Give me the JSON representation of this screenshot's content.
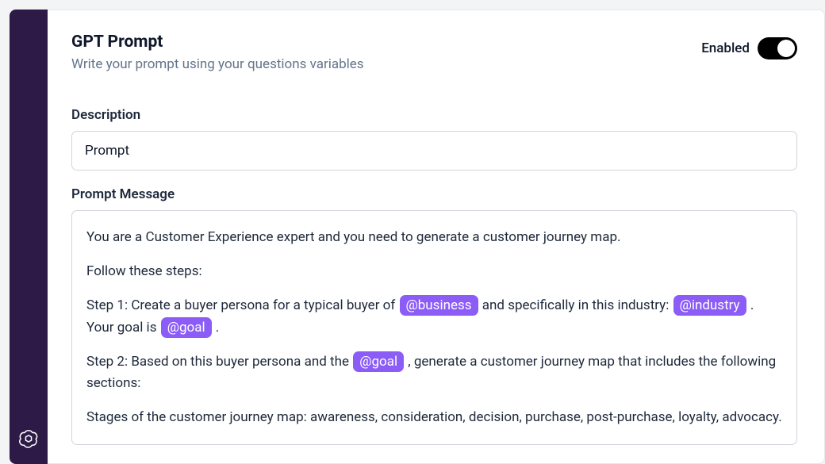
{
  "header": {
    "title": "GPT Prompt",
    "subtitle": "Write your prompt using your questions variables"
  },
  "toggle": {
    "label": "Enabled",
    "state": true
  },
  "fields": {
    "description": {
      "label": "Description",
      "value": "Prompt"
    },
    "promptMessage": {
      "label": "Prompt Message"
    }
  },
  "prompt": {
    "lines": {
      "l1": "You are a Customer Experience expert and you need to generate a customer journey map.",
      "l2": "Follow these steps:",
      "l3_pre": "Step 1: Create a buyer persona for a typical buyer of ",
      "l3_mid1": " and specifically in this industry: ",
      "l3_mid2": " . Your goal is ",
      "l3_end": " .",
      "l4_pre": "Step 2: Based on this buyer persona and the ",
      "l4_post": " , generate a customer journey map that includes the following sections:",
      "l5": "Stages of the customer journey map: awareness, consideration, decision, purchase, post-purchase, loyalty, advocacy."
    },
    "vars": {
      "business": "@business",
      "industry": "@industry",
      "goal": "@goal"
    }
  }
}
